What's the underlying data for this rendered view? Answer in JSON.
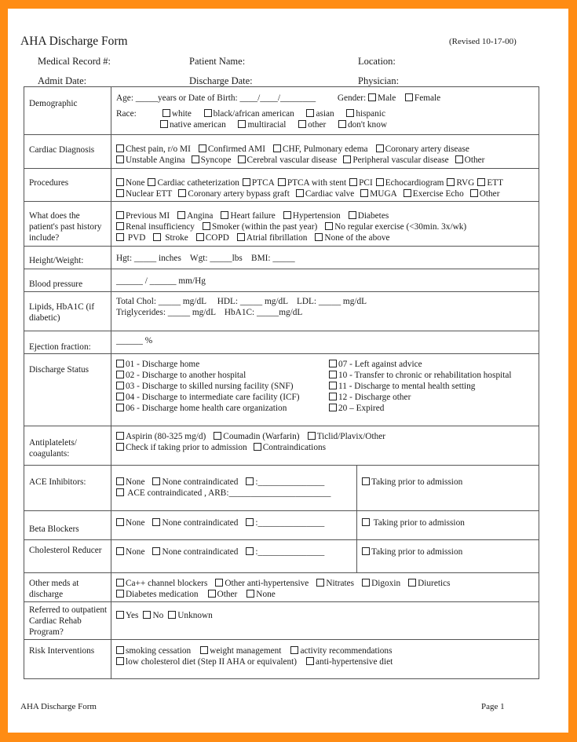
{
  "header": {
    "title": "AHA Discharge Form",
    "revised": "(Revised 10-17-00)",
    "fields": {
      "medical_record": "Medical Record #:",
      "patient_name": "Patient Name:",
      "location": "Location:",
      "admit_date": "Admit Date:",
      "discharge_date": "Discharge Date:",
      "physician": "Physician:"
    }
  },
  "sections": {
    "demographic": {
      "label": "Demographic",
      "age_line": "Age: _____years or Date of Birth: ____/____/________",
      "gender_label": "Gender:",
      "gender_options": [
        "Male",
        "Female"
      ],
      "race_label": "Race:",
      "race_options_row1": [
        "white",
        "black/african american",
        "asian",
        "hispanic"
      ],
      "race_options_row2": [
        "native american",
        "multiracial",
        "other",
        "don't know"
      ]
    },
    "cardiac_diagnosis": {
      "label": "Cardiac Diagnosis",
      "row1": [
        "Chest pain, r/o MI",
        "Confirmed AMI",
        "CHF, Pulmonary edema",
        "Coronary artery disease"
      ],
      "row2": [
        "Unstable Angina",
        "Syncope",
        "Cerebral vascular disease",
        "Peripheral vascular disease",
        "Other"
      ]
    },
    "procedures": {
      "label": "Procedures",
      "row1": [
        "None",
        "Cardiac catheterization",
        "PTCA",
        "PTCA with stent",
        "PCI",
        "Echocardiogram",
        "RVG",
        "ETT"
      ],
      "row2": [
        "Nuclear ETT",
        "Coronary artery bypass graft",
        "Cardiac valve",
        "MUGA",
        "Exercise Echo",
        "Other"
      ]
    },
    "history": {
      "label": "What does the patient's past history include?",
      "row1": [
        "Previous MI",
        "Angina",
        "Heart failure",
        "Hypertension",
        "Diabetes"
      ],
      "row2": [
        "Renal insufficiency",
        "Smoker (within the past year)",
        "No regular exercise (<30min. 3x/wk)"
      ],
      "row3": [
        " PVD",
        " Stroke",
        "COPD",
        "Atrial fibrillation",
        "None of the above"
      ]
    },
    "height_weight": {
      "label": "Height/Weight:",
      "text": "Hgt: _____ inches    Wgt: _____lbs    BMI: _____"
    },
    "blood_pressure": {
      "label": "Blood pressure",
      "text": "______ / ______ mm/Hg"
    },
    "lipids": {
      "label": "Lipids, HbA1C (if diabetic)",
      "line1": "Total Chol: _____ mg/dL     HDL: _____ mg/dL    LDL: _____ mg/dL",
      "line2": "Triglycerides: _____ mg/dL    HbA1C: _____mg/dL"
    },
    "ejection_fraction": {
      "label": "Ejection fraction:",
      "text": "______ %"
    },
    "discharge_status": {
      "label": "Discharge Status",
      "left": [
        "01 - Discharge home",
        "02 - Discharge to another hospital",
        "03 - Discharge to skilled nursing facility (SNF)",
        "04 - Discharge to intermediate care facility (ICF)",
        "06 - Discharge home health care organization"
      ],
      "right": [
        "07 - Left against advice",
        "10 - Transfer to chronic or rehabilitation hospital",
        "11 - Discharge to mental health setting",
        "12 - Discharge other",
        "20 – Expired"
      ]
    },
    "antiplatelets": {
      "label": "Antiplatelets/ coagulants:",
      "row1": [
        "Aspirin (80-325 mg/d)",
        "Coumadin (Warfarin)",
        "Ticlid/Plavix/Other"
      ],
      "row2": [
        "Check if taking prior to admission",
        "Contraindications"
      ]
    },
    "ace_inhibitors": {
      "label": "ACE Inhibitors:",
      "row1": [
        "None",
        "None contraindicated",
        ":_______________"
      ],
      "row2": [
        " ACE contraindicated , ARB:_______________________"
      ],
      "prior": "Taking prior to admission"
    },
    "beta_blockers": {
      "label": "Beta Blockers",
      "row1": [
        "None",
        "None contraindicated",
        ":_______________"
      ],
      "prior": " Taking prior to admission"
    },
    "cholesterol_reducer": {
      "label": "Cholesterol Reducer",
      "row1": [
        "None",
        "None contraindicated",
        ":_______________"
      ],
      "prior": "Taking prior to admission"
    },
    "other_meds": {
      "label": "Other meds at discharge",
      "row1": [
        "Ca++ channel blockers",
        "Other anti-hypertensive",
        "Nitrates",
        "Digoxin",
        "Diuretics"
      ],
      "row2": [
        "Diabetes medication",
        "Other",
        "None"
      ]
    },
    "rehab": {
      "label": "Referred to outpatient Cardiac Rehab Program?",
      "row1": [
        "Yes",
        "No",
        "Unknown"
      ]
    },
    "risk": {
      "label": "Risk Interventions",
      "row1": [
        "smoking cessation",
        "weight management",
        "activity recommendations"
      ],
      "row2": [
        "low cholesterol diet (Step II AHA or equivalent)",
        "anti-hypertensive diet"
      ]
    }
  },
  "footer": {
    "left": "AHA Discharge Form",
    "right": "Page 1"
  },
  "colors": {
    "frame": "#ff8c14",
    "page": "#ffffff",
    "rule": "#555555"
  }
}
